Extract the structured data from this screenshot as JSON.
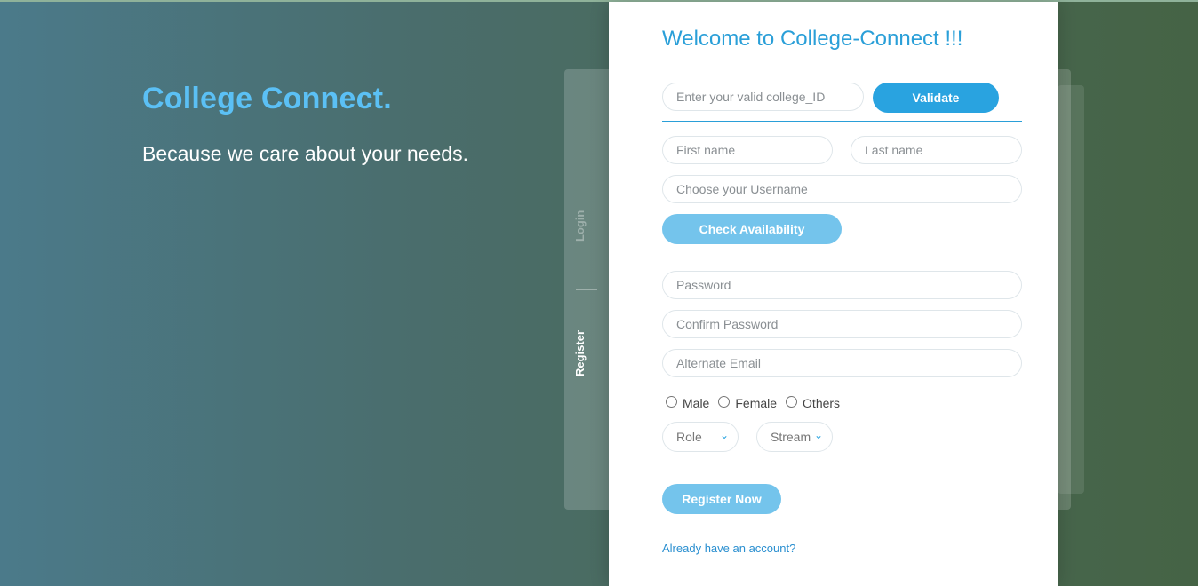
{
  "hero": {
    "title": "College Connect.",
    "subtitle": "Because we care about your needs."
  },
  "side_tabs": {
    "login": "Login",
    "register": "Register"
  },
  "form": {
    "title": "Welcome to College-Connect !!!",
    "college_id": {
      "placeholder": "Enter your valid college_ID",
      "value": ""
    },
    "validate_label": "Validate",
    "first_name": {
      "placeholder": "First name",
      "value": ""
    },
    "last_name": {
      "placeholder": "Last name",
      "value": ""
    },
    "username": {
      "placeholder": "Choose your Username",
      "value": ""
    },
    "check_label": "Check Availability",
    "password": {
      "placeholder": "Password",
      "value": ""
    },
    "confirm_password": {
      "placeholder": "Confirm Password",
      "value": ""
    },
    "alt_email": {
      "placeholder": "Alternate Email",
      "value": ""
    },
    "gender_options": [
      "Male",
      "Female",
      "Others"
    ],
    "role_select": "Role",
    "stream_select": "Stream",
    "register_label": "Register Now",
    "account_link": "Already have an account?"
  },
  "colors": {
    "accent": "#29a3e0",
    "accent_light": "#74c4ec",
    "hero_title": "#5bc0f5"
  }
}
